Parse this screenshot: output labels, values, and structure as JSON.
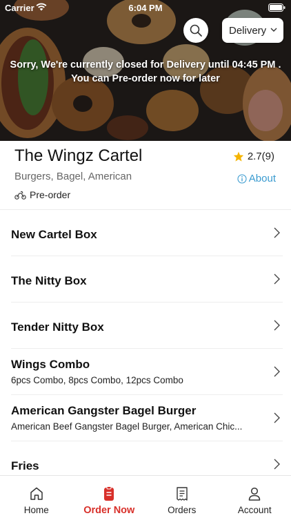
{
  "status_bar": {
    "carrier": "Carrier",
    "time": "6:04 PM"
  },
  "header": {
    "delivery_mode": "Delivery",
    "closed_message_line1": "Sorry, We're currently closed for Delivery until 04:45 PM .",
    "closed_message_line2": "You can Pre-order now for later"
  },
  "restaurant": {
    "name": "The Wingz Cartel",
    "cuisines": "Burgers, Bagel, American",
    "rating": "2.7(9)",
    "about_label": "About",
    "preorder_label": "Pre-order"
  },
  "menu": {
    "items": [
      {
        "title": "New Cartel Box",
        "subtitle": ""
      },
      {
        "title": "The Nitty Box",
        "subtitle": ""
      },
      {
        "title": "Tender Nitty Box",
        "subtitle": ""
      },
      {
        "title": "Wings Combo",
        "subtitle": "6pcs Combo, 8pcs Combo, 12pcs Combo"
      },
      {
        "title": "American Gangster Bagel Burger",
        "subtitle": "American Beef Gangster Bagel Burger, American Chic..."
      },
      {
        "title": "Fries",
        "subtitle": ""
      }
    ]
  },
  "tabbar": {
    "tabs": [
      {
        "label": "Home",
        "icon": "home-icon"
      },
      {
        "label": "Order Now",
        "icon": "order-icon"
      },
      {
        "label": "Orders",
        "icon": "receipt-icon"
      },
      {
        "label": "Account",
        "icon": "person-icon"
      }
    ],
    "active_index": 1
  },
  "colors": {
    "accent": "#d8302a",
    "link": "#3a9bd0",
    "star": "#f5b400"
  }
}
